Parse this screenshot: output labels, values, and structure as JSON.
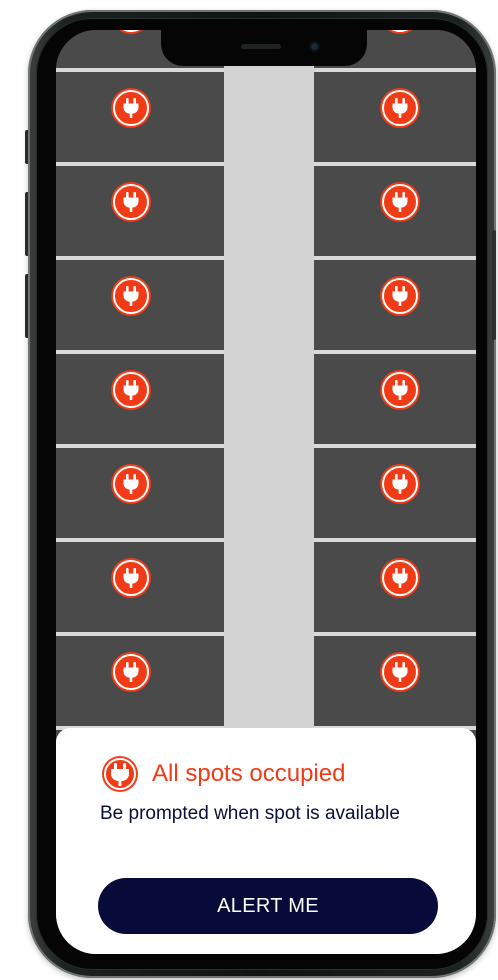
{
  "colors": {
    "accent": "#f13a16",
    "button_bg": "#080b3a",
    "lot_bg": "#4a4a4a",
    "driveway": "#d3d3d3",
    "text_dark": "#0a0f3a"
  },
  "parking": {
    "rows": 8,
    "columns": [
      "left",
      "right"
    ],
    "spot_status": "occupied",
    "spot_icon": "ev-plug-icon"
  },
  "sheet": {
    "icon": "ev-plug-icon",
    "title": "All spots occupied",
    "subtitle": "Be prompted when spot is available",
    "button_label": "ALERT ME"
  }
}
